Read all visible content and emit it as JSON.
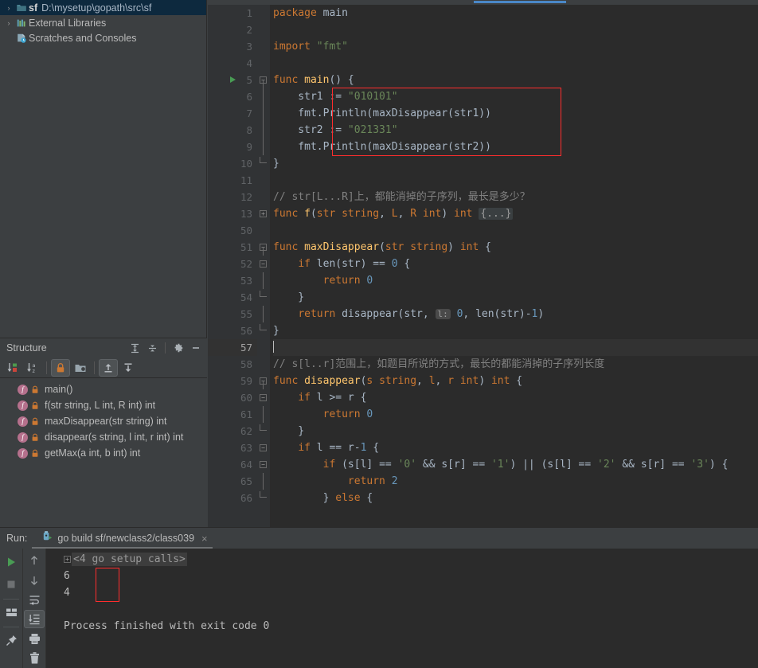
{
  "project": {
    "rows": [
      {
        "arrow": "›",
        "icon": "folder-icon",
        "name": "sf",
        "path": "D:\\mysetup\\gopath\\src\\sf",
        "selected": true
      },
      {
        "arrow": "›",
        "icon": "library-icon",
        "name": "",
        "path": "External Libraries",
        "selected": false
      },
      {
        "arrow": "",
        "icon": "scratches-icon",
        "name": "",
        "path": "Scratches and Consoles",
        "selected": false
      }
    ]
  },
  "structure": {
    "title": "Structure",
    "header_icons": [
      "expand-all-icon",
      "collapse-all-icon",
      "settings-gear-icon",
      "minimize-icon"
    ],
    "toolbar_icons": [
      "sort-by-visibility-icon",
      "sort-alphabetically-icon",
      "show-non-public-icon",
      "group-by-folder-icon",
      "expand-all-icon",
      "collapse-all-icon"
    ],
    "items": [
      {
        "label": "main()"
      },
      {
        "label": "f(str string, L int, R int) int"
      },
      {
        "label": "maxDisappear(str string) int"
      },
      {
        "label": "disappear(s string, l int, r int) int"
      },
      {
        "label": "getMax(a int, b int) int"
      }
    ]
  },
  "editor": {
    "lines": [
      {
        "n": "1",
        "fold": "none",
        "indent": 0,
        "tokens": [
          {
            "t": "kw",
            "v": "package"
          },
          {
            "t": "id",
            "v": " main"
          }
        ]
      },
      {
        "n": "2",
        "fold": "none",
        "indent": 0,
        "tokens": []
      },
      {
        "n": "3",
        "fold": "none",
        "indent": 0,
        "tokens": [
          {
            "t": "kw",
            "v": "import"
          },
          {
            "t": "id",
            "v": " "
          },
          {
            "t": "str",
            "v": "\"fmt\""
          }
        ]
      },
      {
        "n": "4",
        "fold": "none",
        "indent": 0,
        "tokens": []
      },
      {
        "n": "5",
        "fold": "open",
        "run": true,
        "indent": 0,
        "tokens": [
          {
            "t": "kw",
            "v": "func"
          },
          {
            "t": "fn",
            "v": " main"
          },
          {
            "t": "id",
            "v": "() {"
          }
        ]
      },
      {
        "n": "6",
        "fold": "bar",
        "indent": 0,
        "tokens": [
          {
            "t": "id",
            "v": "    str1 := "
          },
          {
            "t": "str",
            "v": "\"010101\""
          }
        ]
      },
      {
        "n": "7",
        "fold": "bar",
        "indent": 0,
        "tokens": [
          {
            "t": "id",
            "v": "    fmt."
          },
          {
            "t": "id",
            "v": "Println(maxDisappear(str1))"
          }
        ]
      },
      {
        "n": "8",
        "fold": "bar",
        "indent": 0,
        "tokens": [
          {
            "t": "id",
            "v": "    str2 := "
          },
          {
            "t": "str",
            "v": "\"021331\""
          }
        ]
      },
      {
        "n": "9",
        "fold": "bar",
        "indent": 0,
        "tokens": [
          {
            "t": "id",
            "v": "    fmt."
          },
          {
            "t": "id",
            "v": "Println(maxDisappear(str2))"
          }
        ]
      },
      {
        "n": "10",
        "fold": "end",
        "indent": 0,
        "tokens": [
          {
            "t": "id",
            "v": "}"
          }
        ]
      },
      {
        "n": "11",
        "fold": "none",
        "indent": 0,
        "tokens": []
      },
      {
        "n": "12",
        "fold": "none",
        "indent": 0,
        "tokens": [
          {
            "t": "cmt",
            "v": "// str[L...R]上，都能消掉的子序列，最长是多少？"
          }
        ]
      },
      {
        "n": "13",
        "fold": "closed",
        "indent": 0,
        "tokens": [
          {
            "t": "kw",
            "v": "func"
          },
          {
            "t": "fn",
            "v": " f"
          },
          {
            "t": "id",
            "v": "("
          },
          {
            "t": "kw",
            "v": "str string"
          },
          {
            "t": "id",
            "v": ", "
          },
          {
            "t": "kw",
            "v": "L"
          },
          {
            "t": "id",
            "v": ", "
          },
          {
            "t": "kw",
            "v": "R int"
          },
          {
            "t": "id",
            "v": ") "
          },
          {
            "t": "kw",
            "v": "int"
          },
          {
            "t": "id",
            "v": " "
          },
          {
            "t": "chip",
            "v": "{...}"
          }
        ]
      },
      {
        "n": "50",
        "fold": "none",
        "indent": 0,
        "tokens": []
      },
      {
        "n": "51",
        "fold": "open",
        "indent": 0,
        "tokens": [
          {
            "t": "kw",
            "v": "func"
          },
          {
            "t": "fn",
            "v": " maxDisappear"
          },
          {
            "t": "id",
            "v": "("
          },
          {
            "t": "kw",
            "v": "str string"
          },
          {
            "t": "id",
            "v": ") "
          },
          {
            "t": "kw",
            "v": "int"
          },
          {
            "t": "id",
            "v": " {"
          }
        ]
      },
      {
        "n": "52",
        "fold": "open2",
        "indent": 0,
        "tokens": [
          {
            "t": "id",
            "v": "    "
          },
          {
            "t": "kw",
            "v": "if"
          },
          {
            "t": "id",
            "v": " len(str) == "
          },
          {
            "t": "num",
            "v": "0"
          },
          {
            "t": "id",
            "v": " {"
          }
        ]
      },
      {
        "n": "53",
        "fold": "bar2",
        "indent": 0,
        "tokens": [
          {
            "t": "id",
            "v": "        "
          },
          {
            "t": "kw",
            "v": "return"
          },
          {
            "t": "id",
            "v": " "
          },
          {
            "t": "num",
            "v": "0"
          }
        ]
      },
      {
        "n": "54",
        "fold": "end2",
        "indent": 0,
        "tokens": [
          {
            "t": "id",
            "v": "    }"
          }
        ]
      },
      {
        "n": "55",
        "fold": "bar",
        "indent": 0,
        "tokens": [
          {
            "t": "id",
            "v": "    "
          },
          {
            "t": "kw",
            "v": "return"
          },
          {
            "t": "id",
            "v": " disappear(str, "
          },
          {
            "t": "hint",
            "v": "l:"
          },
          {
            "t": "id",
            "v": " "
          },
          {
            "t": "num",
            "v": "0"
          },
          {
            "t": "id",
            "v": ", len(str)-"
          },
          {
            "t": "num",
            "v": "1"
          },
          {
            "t": "id",
            "v": ")"
          }
        ]
      },
      {
        "n": "56",
        "fold": "end",
        "indent": 0,
        "tokens": [
          {
            "t": "id",
            "v": "}"
          }
        ]
      },
      {
        "n": "57",
        "fold": "none",
        "current": true,
        "indent": 0,
        "tokens": [
          {
            "t": "caret",
            "v": ""
          }
        ]
      },
      {
        "n": "58",
        "fold": "none",
        "indent": 0,
        "tokens": [
          {
            "t": "cmt",
            "v": "// s[l..r]范围上，如题目所说的方式，最长的都能消掉的子序列长度"
          }
        ]
      },
      {
        "n": "59",
        "fold": "open",
        "indent": 0,
        "tokens": [
          {
            "t": "kw",
            "v": "func"
          },
          {
            "t": "fn",
            "v": " disappear"
          },
          {
            "t": "id",
            "v": "("
          },
          {
            "t": "kw",
            "v": "s string"
          },
          {
            "t": "id",
            "v": ", "
          },
          {
            "t": "kw",
            "v": "l"
          },
          {
            "t": "id",
            "v": ", "
          },
          {
            "t": "kw",
            "v": "r int"
          },
          {
            "t": "id",
            "v": ") "
          },
          {
            "t": "kw",
            "v": "int"
          },
          {
            "t": "id",
            "v": " {"
          }
        ]
      },
      {
        "n": "60",
        "fold": "open2",
        "indent": 0,
        "tokens": [
          {
            "t": "id",
            "v": "    "
          },
          {
            "t": "kw",
            "v": "if"
          },
          {
            "t": "id",
            "v": " l >= r {"
          }
        ]
      },
      {
        "n": "61",
        "fold": "bar2",
        "indent": 0,
        "tokens": [
          {
            "t": "id",
            "v": "        "
          },
          {
            "t": "kw",
            "v": "return"
          },
          {
            "t": "id",
            "v": " "
          },
          {
            "t": "num",
            "v": "0"
          }
        ]
      },
      {
        "n": "62",
        "fold": "end2",
        "indent": 0,
        "tokens": [
          {
            "t": "id",
            "v": "    }"
          }
        ]
      },
      {
        "n": "63",
        "fold": "open2",
        "indent": 0,
        "tokens": [
          {
            "t": "id",
            "v": "    "
          },
          {
            "t": "kw",
            "v": "if"
          },
          {
            "t": "id",
            "v": " l == r-"
          },
          {
            "t": "num",
            "v": "1"
          },
          {
            "t": "id",
            "v": " {"
          }
        ]
      },
      {
        "n": "64",
        "fold": "open3",
        "indent": 0,
        "tokens": [
          {
            "t": "id",
            "v": "        "
          },
          {
            "t": "kw",
            "v": "if"
          },
          {
            "t": "id",
            "v": " (s[l] == "
          },
          {
            "t": "str",
            "v": "'0'"
          },
          {
            "t": "id",
            "v": " && s[r] == "
          },
          {
            "t": "str",
            "v": "'1'"
          },
          {
            "t": "id",
            "v": ") || (s[l] == "
          },
          {
            "t": "str",
            "v": "'2'"
          },
          {
            "t": "id",
            "v": " && s[r] == "
          },
          {
            "t": "str",
            "v": "'3'"
          },
          {
            "t": "id",
            "v": ") {"
          }
        ]
      },
      {
        "n": "65",
        "fold": "bar3",
        "indent": 0,
        "tokens": [
          {
            "t": "id",
            "v": "            "
          },
          {
            "t": "kw",
            "v": "return"
          },
          {
            "t": "id",
            "v": " "
          },
          {
            "t": "num",
            "v": "2"
          }
        ]
      },
      {
        "n": "66",
        "fold": "end3",
        "indent": 0,
        "tokens": [
          {
            "t": "id",
            "v": "        } "
          },
          {
            "t": "kw",
            "v": "else"
          },
          {
            "t": "id",
            "v": " {"
          }
        ]
      }
    ]
  },
  "run": {
    "label": "Run:",
    "tab_title": "go build sf/newclass2/class039",
    "close_glyph": "×",
    "left_toolbar_icons": [
      "run-icon",
      "stop-icon",
      "layout-icon",
      "pin-icon"
    ],
    "right_toolbar_icons": [
      "arrow-up-icon",
      "arrow-down-icon",
      "soft-wrap-icon",
      "scroll-to-end-icon",
      "print-icon",
      "trash-icon"
    ],
    "console_lines": [
      {
        "type": "setup",
        "text": "<4 go setup calls>"
      },
      {
        "type": "out",
        "text": "6"
      },
      {
        "type": "out",
        "text": "4"
      },
      {
        "type": "blank",
        "text": ""
      },
      {
        "type": "status",
        "text": "Process finished with exit code 0"
      }
    ]
  },
  "colors": {
    "editor_bg": "#2b2b2b",
    "panel_bg": "#3c3f41",
    "gutter_bg": "#313335",
    "selection": "#0d293e",
    "accent_blue": "#4a88c7",
    "highlight_red": "#ff2d2d",
    "keyword": "#cc7832",
    "string": "#6a8759",
    "number": "#6897bb",
    "comment": "#808080",
    "function": "#ffc66d",
    "text": "#a9b7c6",
    "run_green": "#499c54"
  }
}
